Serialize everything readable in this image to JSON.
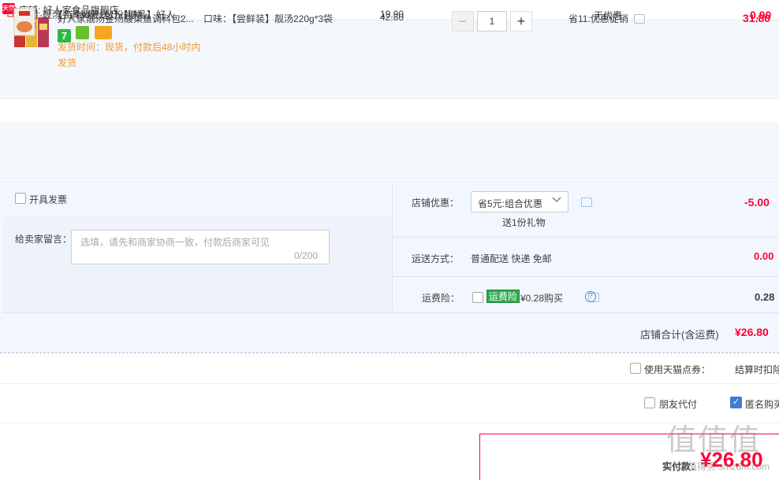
{
  "shop": {
    "badge": "天猫",
    "name": "店铺: 好人家食品旗舰店"
  },
  "item1": {
    "title": "好人家靓汤金汤酸菜鱼调料包2...",
    "sku": "口味：【尝鲜装】靓汤220g*3袋",
    "badge_seven": "7",
    "ship_text": "发货时间：现货，付款后48小时内发货",
    "unit_price": "42.80",
    "quantity": "1",
    "minus": "−",
    "plus": "+",
    "promo": "省11:优惠促销",
    "total": "31.80"
  },
  "gift": {
    "header": "2月-靓汤",
    "header_rule": "满30元送1份礼物",
    "title": "【每个id限1份】【赠品】好人...",
    "unit_price": "19.90",
    "promo": "无优惠",
    "total": "0.00"
  },
  "options": {
    "invoice_label": "开具发票",
    "message_label": "给卖家留言：",
    "message_placeholder": "选填，请先和商家协商一致，付款后商家可见",
    "message_count": "0/200",
    "discount_label": "店铺优惠：",
    "discount_value": "省5元:组合优惠",
    "discount_gift": "送1份礼物",
    "discount_amount": "-5.00",
    "shipping_label": "运送方式：",
    "shipping_value": "普通配送 快递 免邮",
    "shipping_amount": "0.00",
    "insurance_label": "运费险：",
    "insurance_tag": "运费险",
    "insurance_price": "¥0.28购买",
    "insurance_amount": "0.28",
    "help": "?"
  },
  "summary": {
    "shop_total_label": "店铺合计(含运费)",
    "shop_total_amount": "¥26.80",
    "points_label": "使用天猫点券：",
    "points_right": "结算时扣除",
    "friend_pay": "朋友代付",
    "anonymous": "匿名购买",
    "check_mark": "✓",
    "pay_label": "实付款：",
    "pay_amount": "¥26.80"
  },
  "watermark": {
    "big": "值值值",
    "small": "什么值得买 smzdm.com"
  },
  "colors": {
    "accent_red": "#ff0036",
    "row_bg": "#f4f8fd",
    "ship_orange": "#e99a32",
    "check_blue": "#3d7bd6"
  }
}
